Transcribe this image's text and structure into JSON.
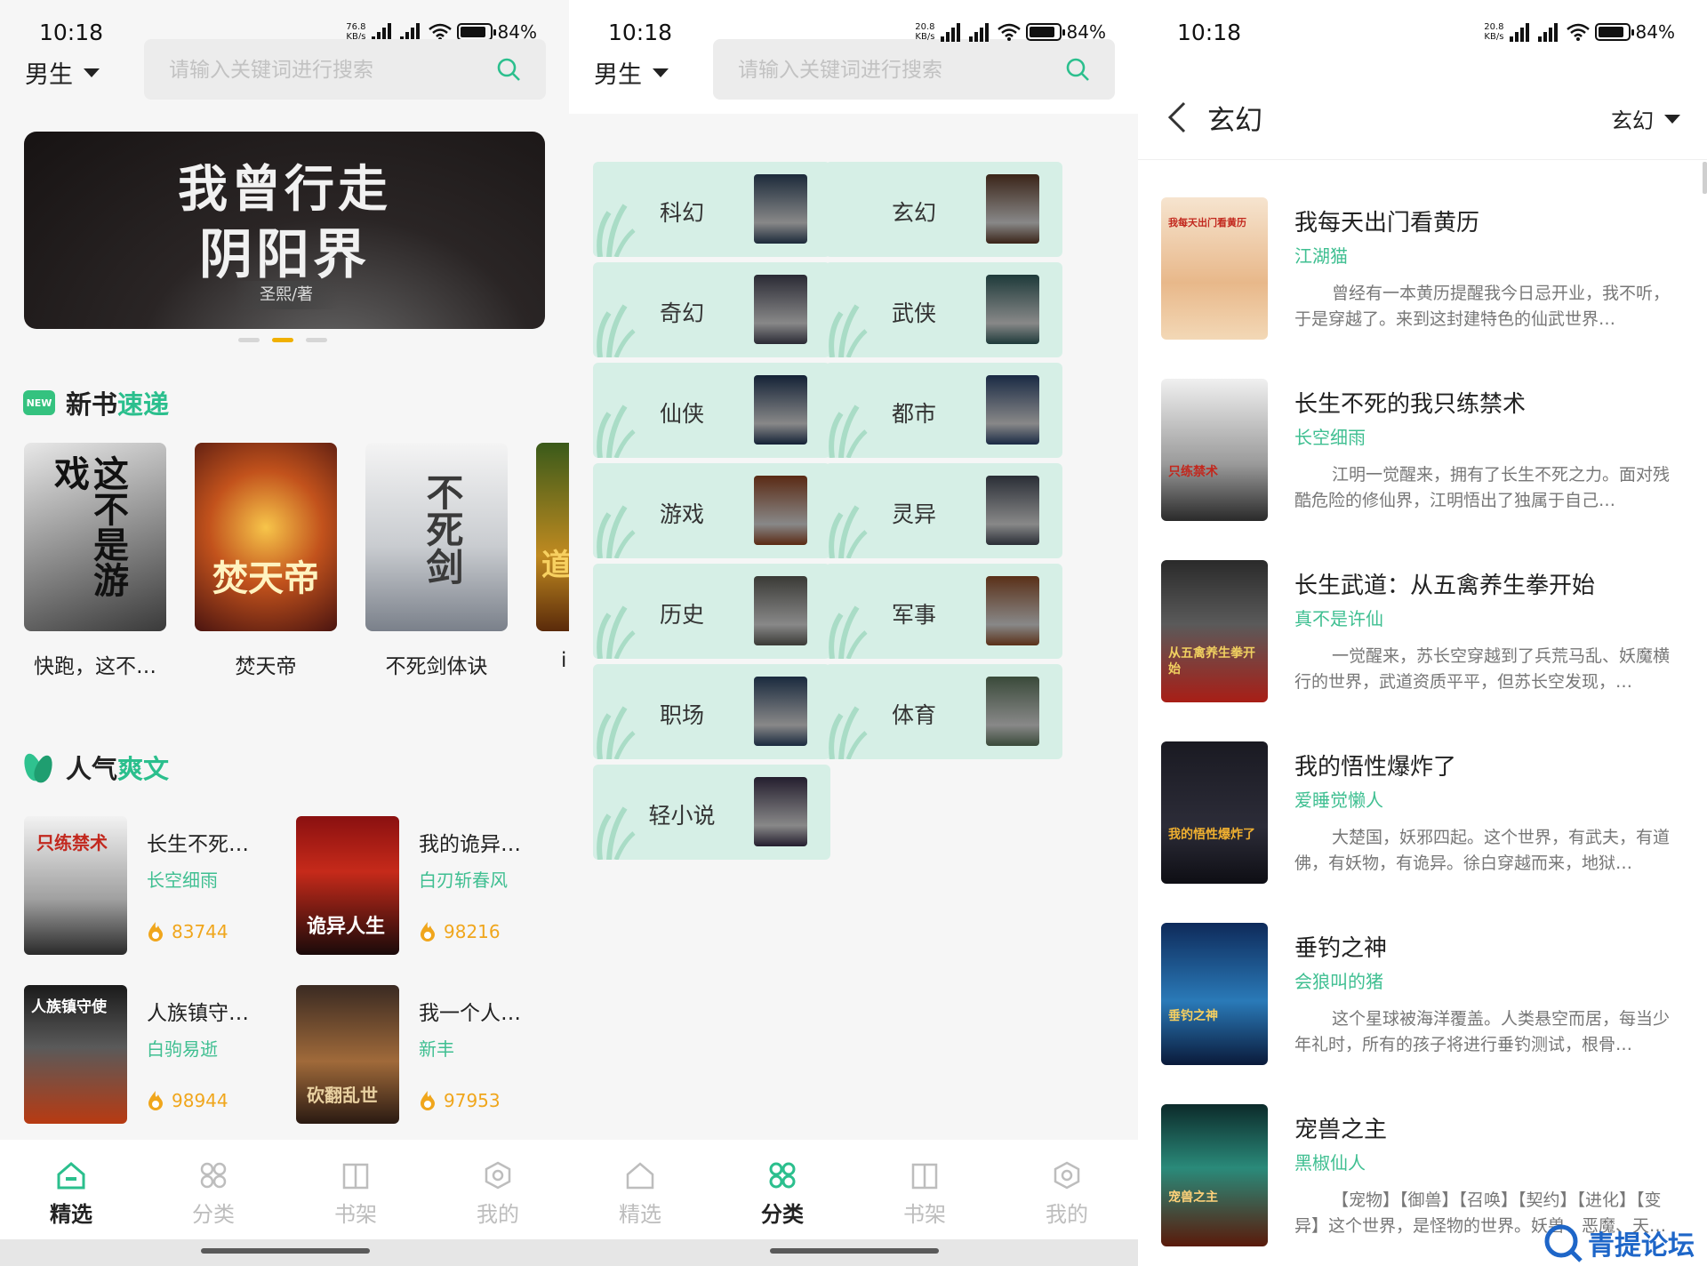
{
  "status": {
    "screen1": {
      "time": "10:18",
      "speed": "76.8",
      "speed_unit": "KB/s",
      "battery": "84%"
    },
    "screen2": {
      "time": "10:18",
      "speed": "20.8",
      "speed_unit": "KB/s",
      "battery": "84%"
    },
    "screen3": {
      "time": "10:18",
      "speed": "20.8",
      "speed_unit": "KB/s",
      "battery": "84%"
    }
  },
  "header": {
    "gender": "男生",
    "search_placeholder": "请输入关键词进行搜索"
  },
  "banner": {
    "title_line1": "我曾行走",
    "title_line2": "阴阳界",
    "author": "圣熙/著",
    "active_dot": 2
  },
  "new_books": {
    "title_a": "新书",
    "title_b": "速递",
    "badge": "NEW",
    "books": [
      {
        "name": "快跑，这不…",
        "cover_text": "这不是游戏"
      },
      {
        "name": "焚天帝",
        "cover_text": "焚天帝"
      },
      {
        "name": "不死剑体诀",
        "cover_text": "不死剑"
      },
      {
        "name": "i",
        "cover_text": "道"
      }
    ]
  },
  "popular": {
    "title_a": "人气",
    "title_b": "爽文",
    "books": [
      {
        "title": "长生不死…",
        "author": "长空细雨",
        "heat": "83744",
        "cover_text": "只练禁术"
      },
      {
        "title": "我的诡异…",
        "author": "白刃斩春风",
        "heat": "98216",
        "cover_text": "诡异人生"
      },
      {
        "title": "人族镇守…",
        "author": "白驹易逝",
        "heat": "98944",
        "cover_text": "人族镇守使"
      },
      {
        "title": "我一个人…",
        "author": "新丰",
        "heat": "97953",
        "cover_text": "砍翻乱世"
      }
    ]
  },
  "tabs": [
    {
      "label": "精选"
    },
    {
      "label": "分类"
    },
    {
      "label": "书架"
    },
    {
      "label": "我的"
    }
  ],
  "categories": [
    {
      "label": "科幻",
      "color": "#1c2a3a"
    },
    {
      "label": "玄幻",
      "color": "#3a2418"
    },
    {
      "label": "奇幻",
      "color": "#2a2a34"
    },
    {
      "label": "武侠",
      "color": "#1e3a3a"
    },
    {
      "label": "仙侠",
      "color": "#142236"
    },
    {
      "label": "都市",
      "color": "#1a2a44"
    },
    {
      "label": "游戏",
      "color": "#5a2a14"
    },
    {
      "label": "灵异",
      "color": "#2a2e36"
    },
    {
      "label": "历史",
      "color": "#3a3a36"
    },
    {
      "label": "军事",
      "color": "#5a3018"
    },
    {
      "label": "职场",
      "color": "#1a2a3e"
    },
    {
      "label": "体育",
      "color": "#3a4a3a"
    },
    {
      "label": "轻小说",
      "color": "#241e2e"
    }
  ],
  "category_page": {
    "title": "玄幻",
    "filter": "玄幻",
    "books": [
      {
        "title": "我每天出门看黄历",
        "author": "江湖猫",
        "desc": "曾经有一本黄历提醒我今日忌开业，我不听，于是穿越了。来到这封建特色的仙武世界…",
        "cover_text": "我每天出门看黄历"
      },
      {
        "title": "长生不死的我只练禁术",
        "author": "长空细雨",
        "desc": "江明一觉醒来，拥有了长生不死之力。面对残酷危险的修仙界，江明悟出了独属于自己…",
        "cover_text": "只练禁术"
      },
      {
        "title": "长生武道：从五禽养生拳开始",
        "author": "真不是许仙",
        "desc": "一觉醒来，苏长空穿越到了兵荒马乱、妖魔横行的世界，武道资质平平，但苏长空发现，…",
        "cover_text": "从五禽养生拳开始"
      },
      {
        "title": "我的悟性爆炸了",
        "author": "爱睡觉懒人",
        "desc": "大楚国，妖邪四起。这个世界，有武夫，有道佛，有妖物，有诡异。徐白穿越而来，地狱…",
        "cover_text": "我的悟性爆炸了"
      },
      {
        "title": "垂钓之神",
        "author": "会狼叫的猪",
        "desc": "这个星球被海洋覆盖。人类悬空而居，每当少年礼时，所有的孩子将进行垂钓测试，根骨…",
        "cover_text": "垂钓之神"
      },
      {
        "title": "宠兽之主",
        "author": "黑椒仙人",
        "desc": "【宠物】【御兽】【召唤】【契约】【进化】【变异】这个世界，是怪物的世界。妖兽、恶魔、天…",
        "cover_text": "宠兽之主"
      }
    ]
  },
  "watermark": "青提论坛",
  "colors": {
    "accent": "#2bbf8d",
    "heat": "#f0a61c",
    "category_bg": "#d6efe6",
    "dot_active": "#f0b000"
  }
}
